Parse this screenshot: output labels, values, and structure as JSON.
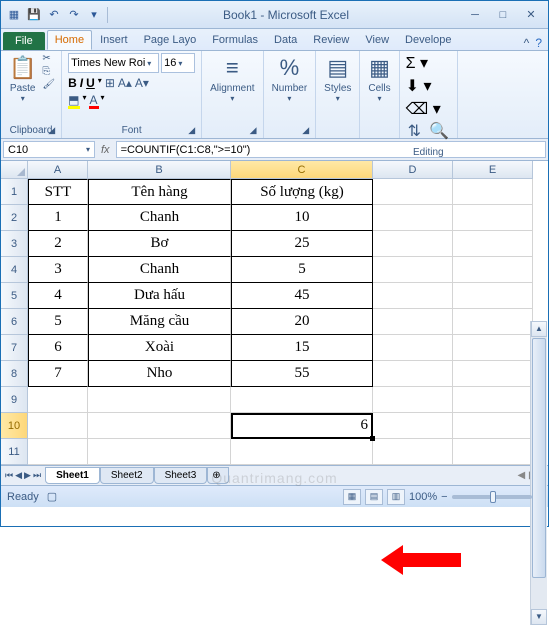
{
  "title": "Book1 - Microsoft Excel",
  "tabs": {
    "file": "File",
    "home": "Home",
    "insert": "Insert",
    "pageLayout": "Page Layo",
    "formulas": "Formulas",
    "data": "Data",
    "review": "Review",
    "view": "View",
    "developer": "Develope"
  },
  "ribbon": {
    "clipboard": {
      "label": "Clipboard",
      "paste": "Paste"
    },
    "font": {
      "label": "Font",
      "name": "Times New Roi",
      "size": "16",
      "bold": "B",
      "italic": "I",
      "underline": "U"
    },
    "alignment": {
      "label": "Alignment"
    },
    "number": {
      "label": "Number"
    },
    "styles": {
      "label": "Styles"
    },
    "cells": {
      "label": "Cells"
    },
    "editing": {
      "label": "Editing"
    }
  },
  "nameBox": "C10",
  "formula": "=COUNTIF(C1:C8,\">=10\")",
  "fx": "fx",
  "columns": [
    "A",
    "B",
    "C",
    "D",
    "E"
  ],
  "table": {
    "headers": {
      "stt": "STT",
      "ten": "Tên hàng",
      "sl": "Số lượng (kg)"
    },
    "rows": [
      {
        "stt": "1",
        "ten": "Chanh",
        "sl": "10"
      },
      {
        "stt": "2",
        "ten": "Bơ",
        "sl": "25"
      },
      {
        "stt": "3",
        "ten": "Chanh",
        "sl": "5"
      },
      {
        "stt": "4",
        "ten": "Dưa hấu",
        "sl": "45"
      },
      {
        "stt": "5",
        "ten": "Măng cầu",
        "sl": "20"
      },
      {
        "stt": "6",
        "ten": "Xoài",
        "sl": "15"
      },
      {
        "stt": "7",
        "ten": "Nho",
        "sl": "55"
      }
    ]
  },
  "result": "6",
  "sheets": {
    "s1": "Sheet1",
    "s2": "Sheet2",
    "s3": "Sheet3"
  },
  "status": {
    "ready": "Ready",
    "caps": "🔲",
    "zoom": "100%",
    "minus": "−",
    "plus": "+"
  },
  "watermark": "Quantrimang.com"
}
